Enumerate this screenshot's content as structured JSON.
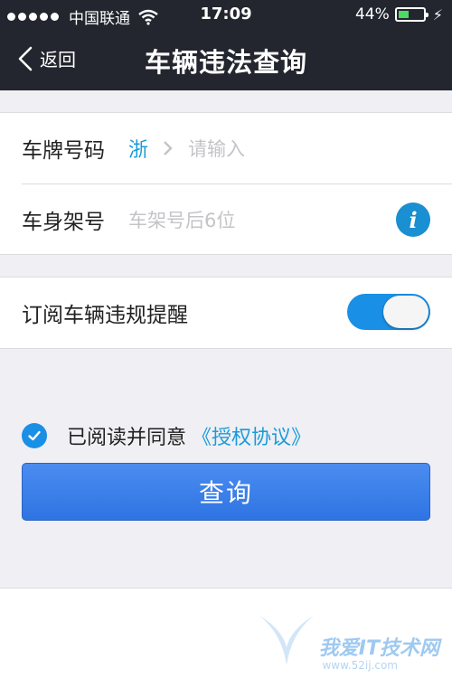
{
  "status_bar": {
    "carrier": "中国联通",
    "time": "17:09",
    "battery_percent": "44%",
    "battery_level": 0.44
  },
  "nav": {
    "back_label": "返回",
    "title": "车辆违法查询"
  },
  "form": {
    "plate_label": "车牌号码",
    "plate_province": "浙",
    "plate_placeholder": "请输入",
    "vin_label": "车身架号",
    "vin_placeholder": "车架号后6位"
  },
  "subscribe": {
    "label": "订阅车辆违规提醒",
    "enabled": true
  },
  "agreement": {
    "text": "已阅读并同意",
    "link": "《授权协议》",
    "checked": true
  },
  "query_button": "查询",
  "watermark": {
    "text": "我爱IT技术网",
    "url": "www.52ij.com"
  },
  "colors": {
    "nav_bg": "#23262e",
    "accent": "#1a8fe6",
    "button": "#2f74e3",
    "battery": "#4cd964"
  }
}
